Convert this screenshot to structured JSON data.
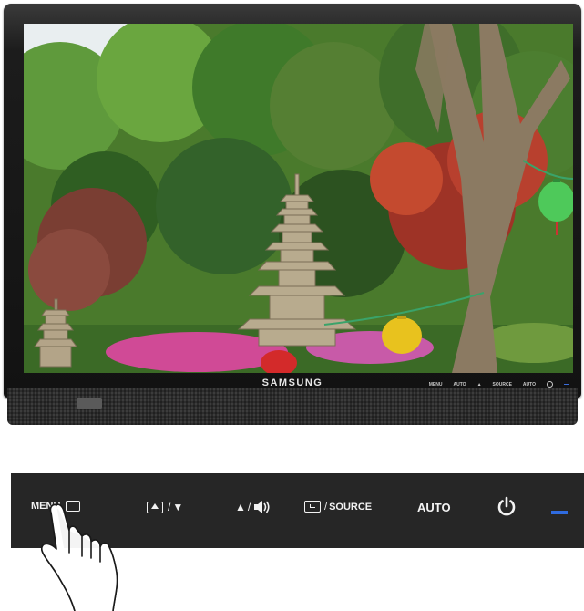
{
  "monitor": {
    "brand": "SAMSUNG",
    "mini_button_labels": [
      "MENU",
      "AUTO",
      "▲",
      "SOURCE",
      "AUTO"
    ]
  },
  "button_bar": {
    "menu_label": "MENU",
    "brightness_icon": "brightness-box-icon",
    "brightness_arrow": "▼",
    "separator": "/",
    "volume_arrow": "▲",
    "volume_icon": "speaker-icon",
    "source_label": "SOURCE",
    "auto_label": "AUTO",
    "power_icon": "power-icon",
    "power_led_color": "#2f6bdf"
  },
  "colors": {
    "bar_background": "#262626",
    "bezel": "#1c1c1c",
    "label": "#f2f2f2"
  }
}
